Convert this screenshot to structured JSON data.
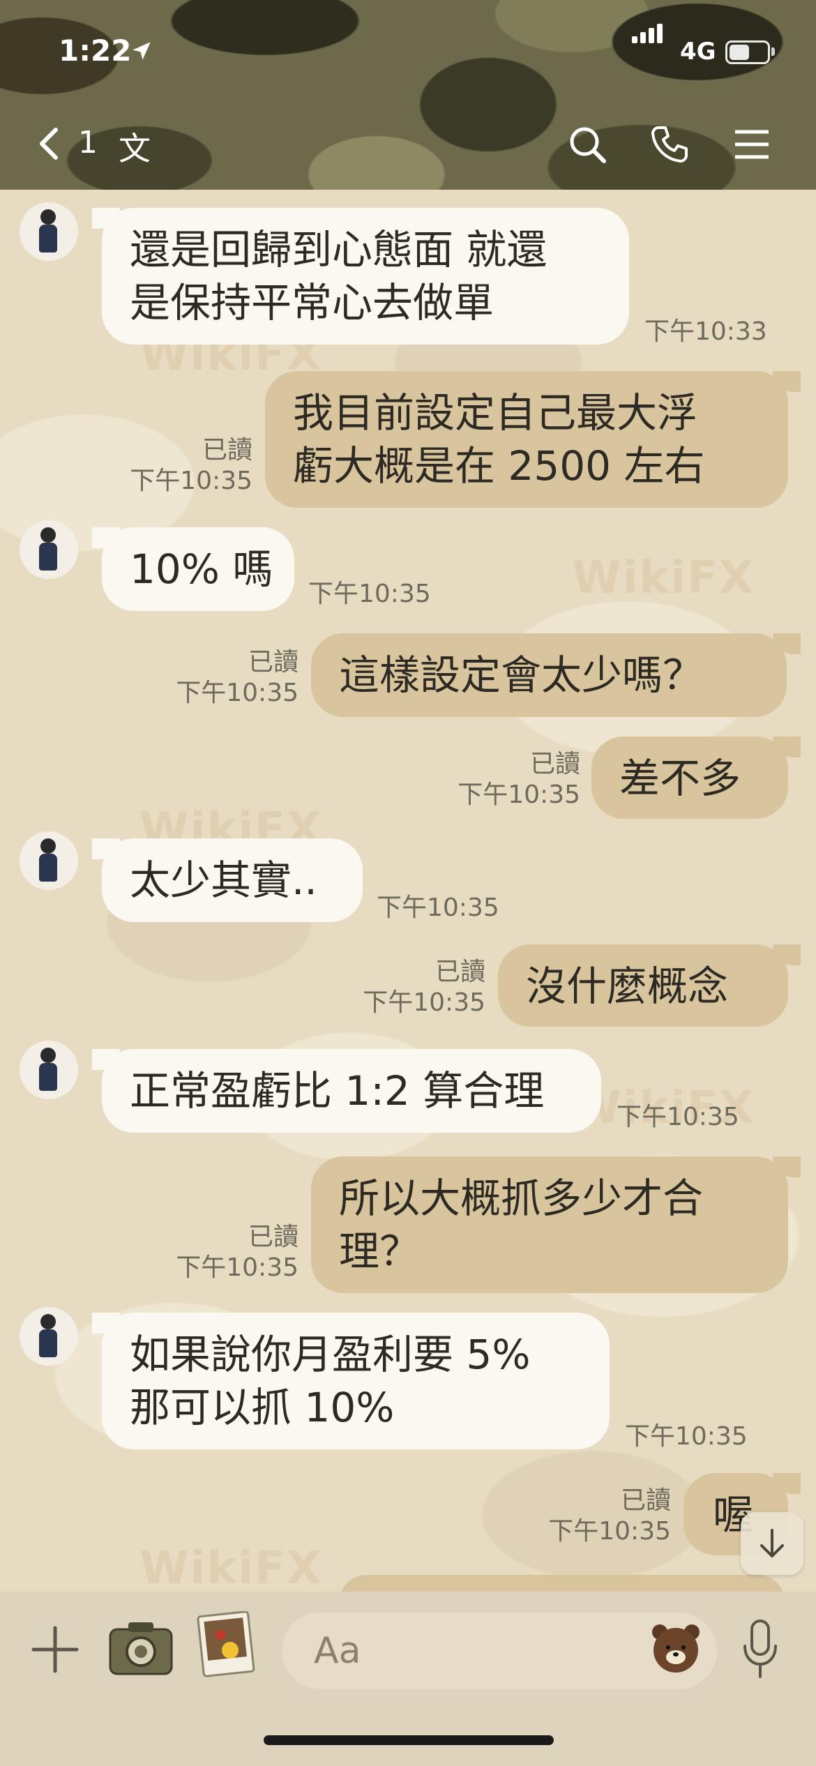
{
  "status_bar": {
    "time": "1:22",
    "network": "4G"
  },
  "nav": {
    "back_count": "1",
    "title": "文"
  },
  "watermark": "WikiFX",
  "messages": [
    {
      "dir": "in",
      "lines": [
        "還是回歸到心態面 就還",
        "是保持平常心去做單"
      ],
      "time": "下午10:33"
    },
    {
      "dir": "out",
      "lines": [
        "我目前設定自己最大浮",
        "虧大概是在 2500 左右"
      ],
      "read": "已讀",
      "time": "下午10:35"
    },
    {
      "dir": "in",
      "lines": [
        "10% 嗎"
      ],
      "time": "下午10:35"
    },
    {
      "dir": "out",
      "lines": [
        "這樣設定會太少嗎？"
      ],
      "read": "已讀",
      "time": "下午10:35"
    },
    {
      "dir": "out",
      "lines": [
        "差不多"
      ],
      "read": "已讀",
      "time": "下午10:35"
    },
    {
      "dir": "in",
      "lines": [
        "太少其實.."
      ],
      "time": "下午10:35"
    },
    {
      "dir": "out",
      "lines": [
        "沒什麼概念"
      ],
      "read": "已讀",
      "time": "下午10:35"
    },
    {
      "dir": "in",
      "lines": [
        "正常盈虧比 1:2 算合理"
      ],
      "time": "下午10:35"
    },
    {
      "dir": "out",
      "lines": [
        "所以大概抓多少才合",
        "理？"
      ],
      "read": "已讀",
      "time": "下午10:35"
    },
    {
      "dir": "in",
      "lines": [
        "如果說你月盈利要 5%",
        "那可以抓 10%"
      ],
      "time": "下午10:35"
    },
    {
      "dir": "out",
      "lines": [
        "喔"
      ],
      "read": "已讀",
      "time": "下午10:35"
    }
  ],
  "input": {
    "placeholder": "Aa"
  },
  "icons": {
    "back": "chevron-left-icon",
    "search": "search-icon",
    "call": "phone-icon",
    "menu": "hamburger-menu-icon",
    "plus": "plus-icon",
    "camera": "camera-icon",
    "photo": "photo-icon",
    "sticker": "bear-sticker-icon",
    "mic": "microphone-icon",
    "scroll": "arrow-down-icon"
  }
}
